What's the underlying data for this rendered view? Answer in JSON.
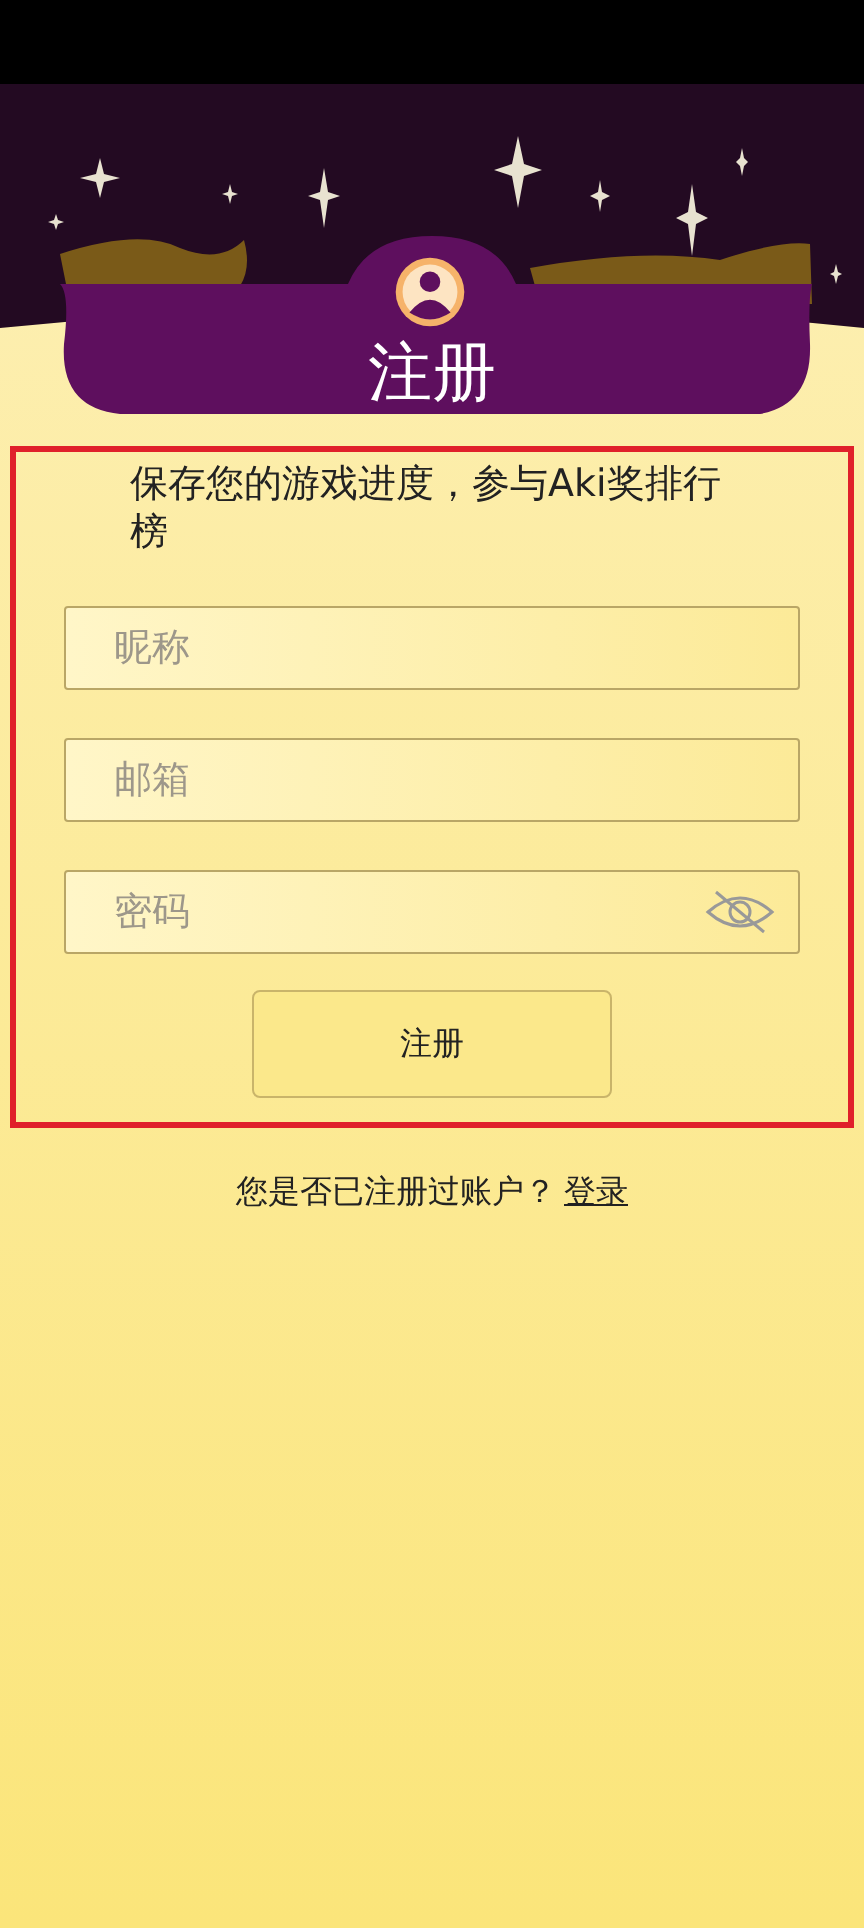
{
  "header": {
    "title": "注册"
  },
  "form": {
    "highlighted": true,
    "intro": "保存您的游戏进度，参与Aki奖排行榜",
    "fields": [
      {
        "kind": "text",
        "placeholder": "昵称"
      },
      {
        "kind": "text",
        "placeholder": "邮箱"
      },
      {
        "kind": "password",
        "placeholder": "密码"
      }
    ],
    "submit": "注册"
  },
  "footer": {
    "question": "您是否已注册过账户？",
    "link": "登录"
  }
}
